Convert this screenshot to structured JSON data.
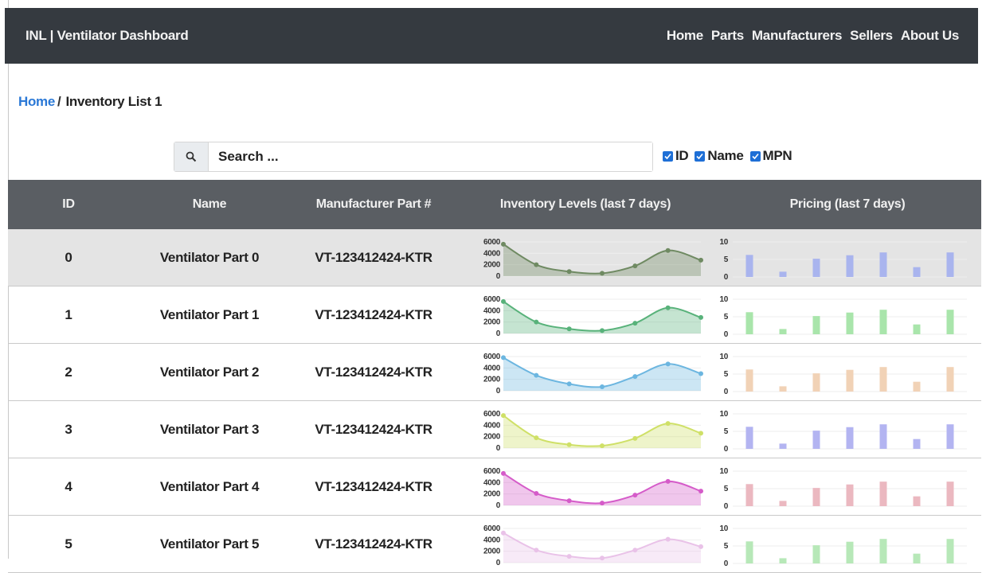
{
  "navbar": {
    "brand": "INL | Ventilator Dashboard",
    "links": [
      "Home",
      "Parts",
      "Manufacturers",
      "Sellers",
      "About Us"
    ]
  },
  "breadcrumb": {
    "home": "Home",
    "separator": "/",
    "current": "Inventory List 1"
  },
  "search": {
    "placeholder": "Search ...",
    "icon": "search-icon"
  },
  "filters": [
    {
      "label": "ID",
      "checked": true
    },
    {
      "label": "Name",
      "checked": true
    },
    {
      "label": "MPN",
      "checked": true
    }
  ],
  "table": {
    "columns": [
      "ID",
      "Name",
      "Manufacturer Part #",
      "Inventory Levels (last 7 days)",
      "Pricing (last 7 days)"
    ],
    "rows": [
      {
        "id": "0",
        "name": "Ventilator Part 0",
        "mpn": "VT-123412424-KTR",
        "color": "#6f8a62",
        "selected": true
      },
      {
        "id": "1",
        "name": "Ventilator Part 1",
        "mpn": "VT-123412424-KTR",
        "color": "#58b27a",
        "selected": false
      },
      {
        "id": "2",
        "name": "Ventilator Part 2",
        "mpn": "VT-123412424-KTR",
        "color": "#6cb6e0",
        "selected": false
      },
      {
        "id": "3",
        "name": "Ventilator Part 3",
        "mpn": "VT-123412424-KTR",
        "color": "#cfe067",
        "selected": false
      },
      {
        "id": "4",
        "name": "Ventilator Part 4",
        "mpn": "VT-123412424-KTR",
        "color": "#d55bc9",
        "selected": false
      },
      {
        "id": "5",
        "name": "Ventilator Part 5",
        "mpn": "VT-123412424-KTR",
        "color": "#e9c2e8",
        "selected": false
      }
    ]
  },
  "chart_data": [
    {
      "type": "area",
      "title": "Inventory Levels (last 7 days)",
      "yticks": [
        "6000",
        "4000",
        "2000",
        "0"
      ],
      "ylim": [
        0,
        6000
      ],
      "series_by_row": [
        [
          5600,
          2000,
          800,
          500,
          1800,
          4500,
          2800
        ],
        [
          5600,
          2000,
          800,
          500,
          1800,
          4500,
          2800
        ],
        [
          5800,
          2700,
          1200,
          700,
          2500,
          4700,
          3000
        ],
        [
          5700,
          1800,
          600,
          400,
          1700,
          4300,
          2600
        ],
        [
          5600,
          2100,
          800,
          400,
          1800,
          4200,
          2500
        ],
        [
          5200,
          2200,
          1100,
          800,
          2200,
          4100,
          2800
        ]
      ]
    },
    {
      "type": "bar",
      "title": "Pricing (last 7 days)",
      "yticks": [
        "10",
        "5",
        "0"
      ],
      "ylim": [
        0,
        10
      ],
      "bar_colors": [
        "#a9b4ee",
        "#a9e5ab",
        "#f1d2b6",
        "#b3b4f1",
        "#ebb8c0",
        "#b7e8b8"
      ],
      "series_by_row": [
        [
          6.3,
          1.5,
          5.2,
          6.2,
          7.0,
          2.8,
          7.0
        ],
        [
          6.3,
          1.5,
          5.2,
          6.2,
          7.0,
          2.8,
          7.0
        ],
        [
          6.3,
          1.5,
          5.2,
          6.2,
          7.0,
          2.8,
          7.0
        ],
        [
          6.3,
          1.5,
          5.2,
          6.2,
          7.0,
          2.8,
          7.0
        ],
        [
          6.3,
          1.5,
          5.2,
          6.2,
          7.0,
          2.8,
          7.0
        ],
        [
          6.3,
          1.5,
          5.2,
          6.2,
          7.0,
          2.8,
          7.0
        ]
      ]
    }
  ]
}
